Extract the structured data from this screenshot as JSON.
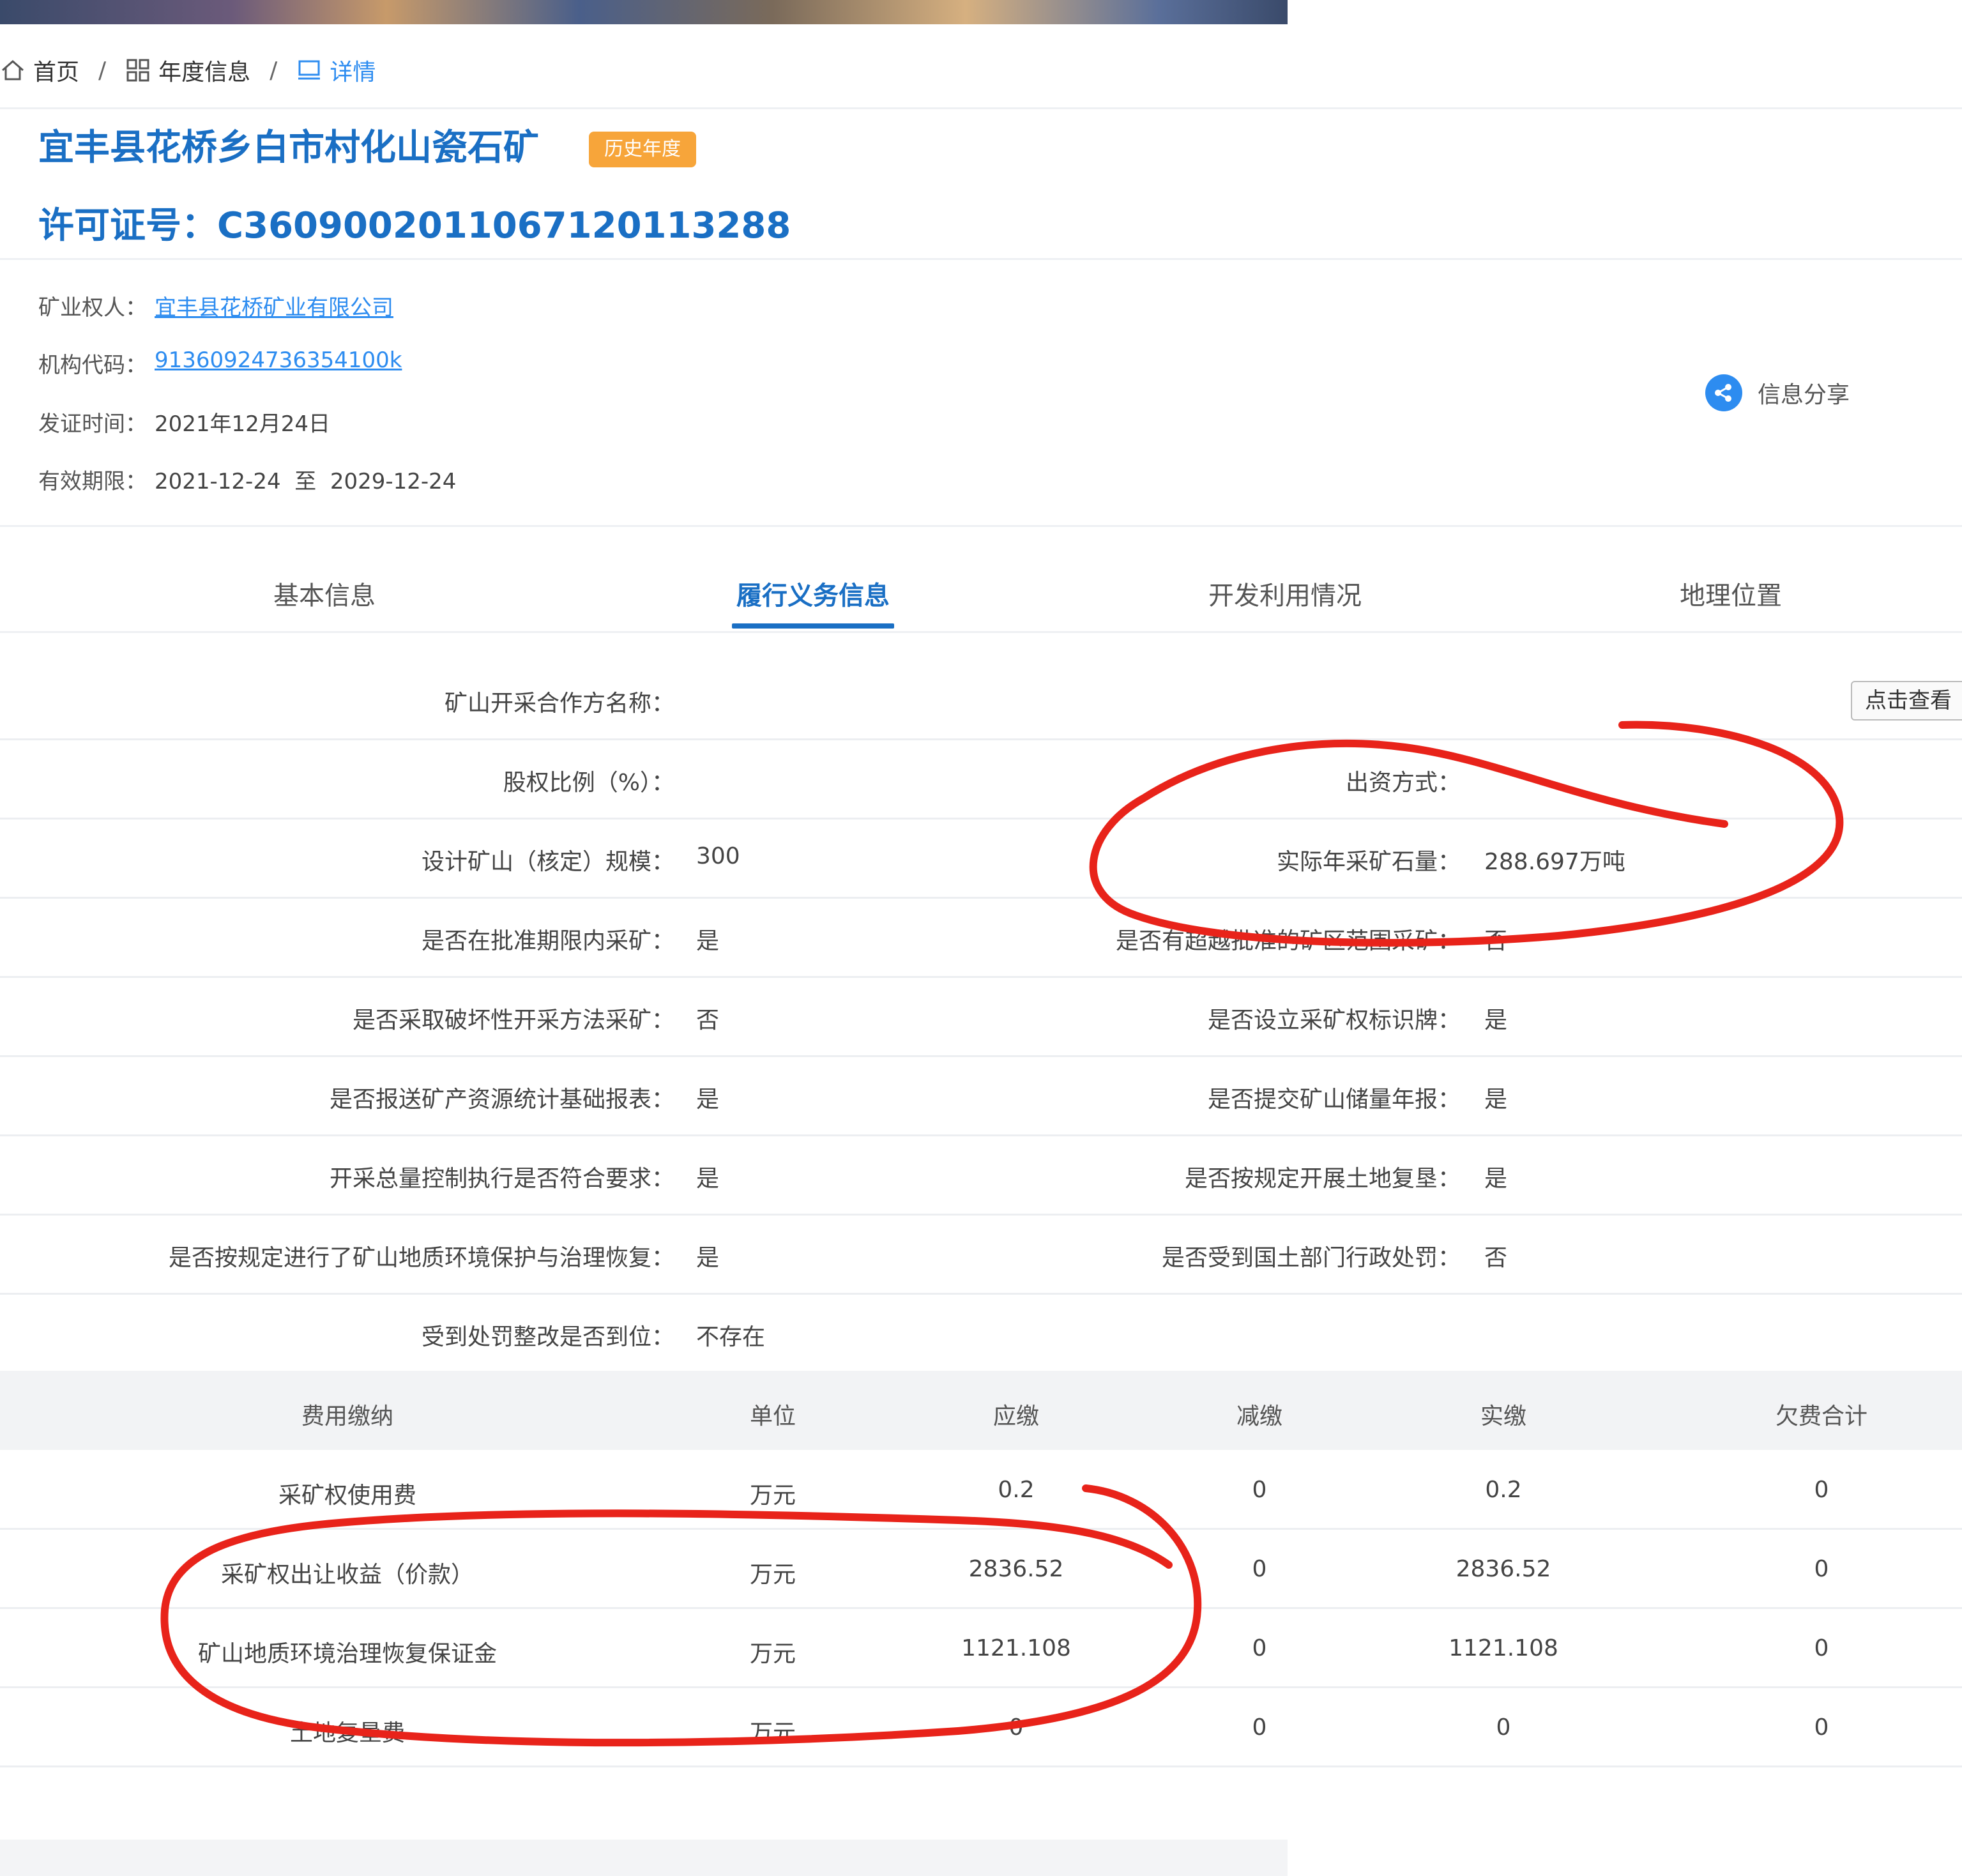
{
  "breadcrumb": [
    {
      "label": "首页",
      "icon": "home-icon"
    },
    {
      "label": "年度信息",
      "icon": "grid-icon"
    },
    {
      "label": "详情",
      "icon": "monitor-icon"
    }
  ],
  "breadcrumb_separator": "/",
  "header": {
    "mine_name": "宜丰县花桥乡白市村化山瓷石矿",
    "badge": "历史年度",
    "license": "许可证号：C3609002011067120113288"
  },
  "info": {
    "owner_label": "矿业权人：",
    "owner_value": "宜丰县花桥矿业有限公司",
    "code_label": "机构代码：",
    "code_value": "91360924736354100k",
    "issue_label": "发证时间：",
    "issue_value": "2021年12月24日",
    "valid_label": "有效期限：",
    "valid_value": "2021-12-24  至  2029-12-24",
    "share_label": "信息分享"
  },
  "tabs": [
    "基本信息",
    "履行义务信息",
    "开发利用情况",
    "地理位置"
  ],
  "active_tab": 1,
  "details": {
    "cooperator_label": "矿山开采合作方名称：",
    "view_button": "点击查看",
    "equity_label": "股权比例（%）：",
    "funding_label": "出资方式：",
    "design_scale_label": "设计矿山（核定）规模：",
    "design_scale_value": "300",
    "actual_output_label": "实际年采矿石量：",
    "actual_output_value": "288.697万吨",
    "within_period_label": "是否在批准期限内采矿：",
    "within_period_value": "是",
    "beyond_scope_label": "是否有超越批准的矿区范围采矿：",
    "beyond_scope_value": "否",
    "destructive_label": "是否采取破坏性开采方法采矿：",
    "destructive_value": "否",
    "sign_label": "是否设立采矿权标识牌：",
    "sign_value": "是",
    "stat_report_label": "是否报送矿产资源统计基础报表：",
    "stat_report_value": "是",
    "reserve_report_label": "是否提交矿山储量年报：",
    "reserve_report_value": "是",
    "total_control_label": "开采总量控制执行是否符合要求：",
    "total_control_value": "是",
    "land_reclaim_label": "是否按规定开展土地复垦：",
    "land_reclaim_value": "是",
    "env_restore_label": "是否按规定进行了矿山地质环境保护与治理恢复：",
    "env_restore_value": "是",
    "penalty_label": "是否受到国土部门行政处罚：",
    "penalty_value": "否",
    "rectify_label": "受到处罚整改是否到位：",
    "rectify_value": "不存在"
  },
  "fees": {
    "headers": [
      "费用缴纳",
      "单位",
      "应缴",
      "减缴",
      "实缴",
      "欠费合计"
    ],
    "rows": [
      [
        "采矿权使用费",
        "万元",
        "0.2",
        "0",
        "0.2",
        "0"
      ],
      [
        "采矿权出让收益（价款）",
        "万元",
        "2836.52",
        "0",
        "2836.52",
        "0"
      ],
      [
        "矿山地质环境治理恢复保证金",
        "万元",
        "1121.108",
        "0",
        "1121.108",
        "0"
      ],
      [
        "土地复垦费",
        "万元",
        "0",
        "0",
        "0",
        "0"
      ]
    ]
  },
  "colors": {
    "accent": "#1a6fc4",
    "link": "#2d8cf0",
    "badge": "#f7a53a",
    "annotation": "#e8231a"
  }
}
